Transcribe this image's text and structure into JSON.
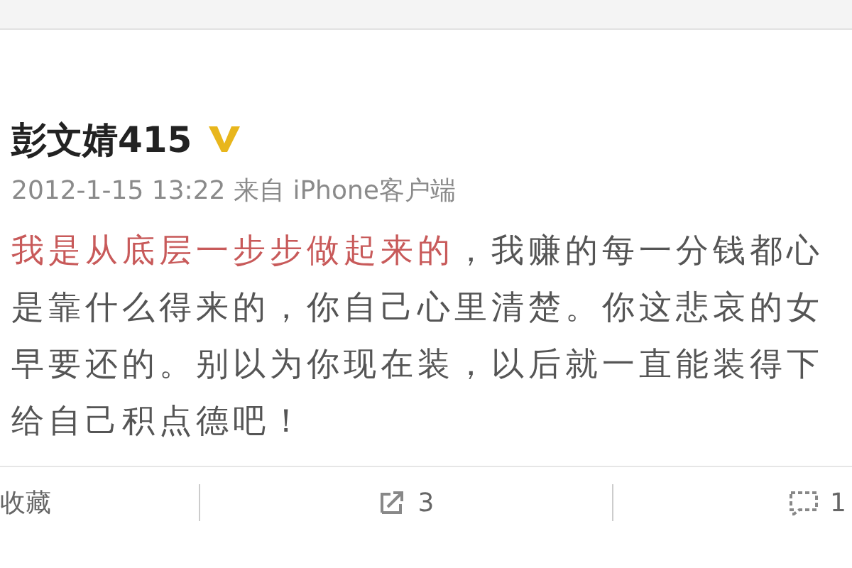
{
  "post": {
    "author": "彭文婧415",
    "verified": true,
    "meta": "2012-1-15 13:22 来自 iPhone客户端",
    "lines": [
      {
        "highlight": "我是从底层一步步做起来的",
        "text": "，我赚的每一分钱都心"
      },
      {
        "text": "是靠什么得来的，你自己心里清楚。你这悲哀的女"
      },
      {
        "text": "早要还的。别以为你现在装，以后就一直能装得下"
      },
      {
        "text": "给自己积点德吧！"
      }
    ]
  },
  "actions": [
    {
      "kind": "favorite",
      "label": "收藏"
    },
    {
      "kind": "repost",
      "count": "3"
    },
    {
      "kind": "comment",
      "count": "1"
    }
  ]
}
